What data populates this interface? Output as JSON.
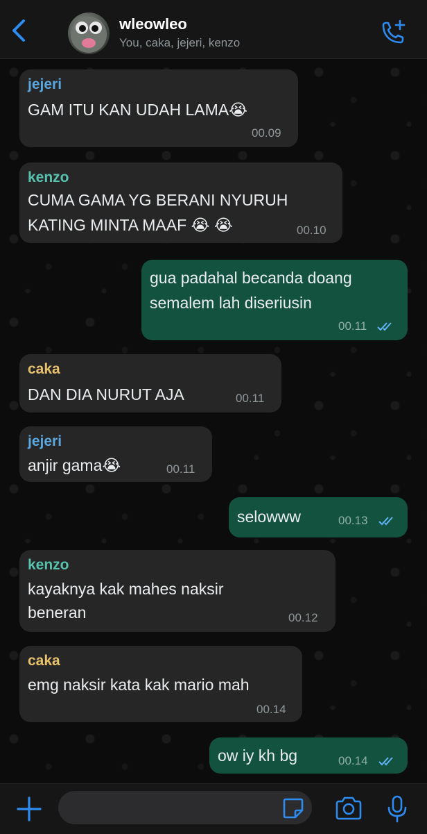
{
  "header": {
    "title": "wleowleo",
    "participants": "You, caka, jejeri, kenzo"
  },
  "colors": {
    "jejeri": "#5ba7e0",
    "kenzo": "#57c2ad",
    "caka": "#e6c26e",
    "accent": "#2e8bf0",
    "outgoing_bubble": "#145240",
    "incoming_bubble": "#262626"
  },
  "messages": [
    {
      "sender": "jejeri",
      "lines": [
        "GAM ITU KAN UDAH LAMA😭"
      ],
      "time": "00.09"
    },
    {
      "sender": "kenzo",
      "lines": [
        "CUMA GAMA YG BERANI NYURUH",
        "KATING MINTA MAAF 😭 😭"
      ],
      "time": "00.10"
    },
    {
      "lines": [
        "gua padahal becanda doang",
        "semalem lah diseriusin"
      ],
      "time": "00.11",
      "read": true
    },
    {
      "sender": "caka",
      "lines": [
        "DAN DIA NURUT AJA"
      ],
      "time": "00.11"
    },
    {
      "sender": "jejeri",
      "lines": [
        "anjir gama😭"
      ],
      "time": "00.11"
    },
    {
      "lines": [
        "selowww"
      ],
      "time": "00.13",
      "read": true
    },
    {
      "sender": "kenzo",
      "lines": [
        "kayaknya kak mahes naksir",
        "beneran"
      ],
      "time": "00.12"
    },
    {
      "sender": "caka",
      "lines": [
        "emg naksir kata kak mario mah"
      ],
      "time": "00.14"
    },
    {
      "lines": [
        "ow iy kh bg"
      ],
      "time": "00.14",
      "read": true
    }
  ],
  "icons": {
    "back": "chevron-left-icon",
    "call": "phone-plus-icon",
    "attach": "plus-icon",
    "sticker": "sticker-icon",
    "camera": "camera-icon",
    "mic": "microphone-icon",
    "read": "double-check-icon"
  }
}
